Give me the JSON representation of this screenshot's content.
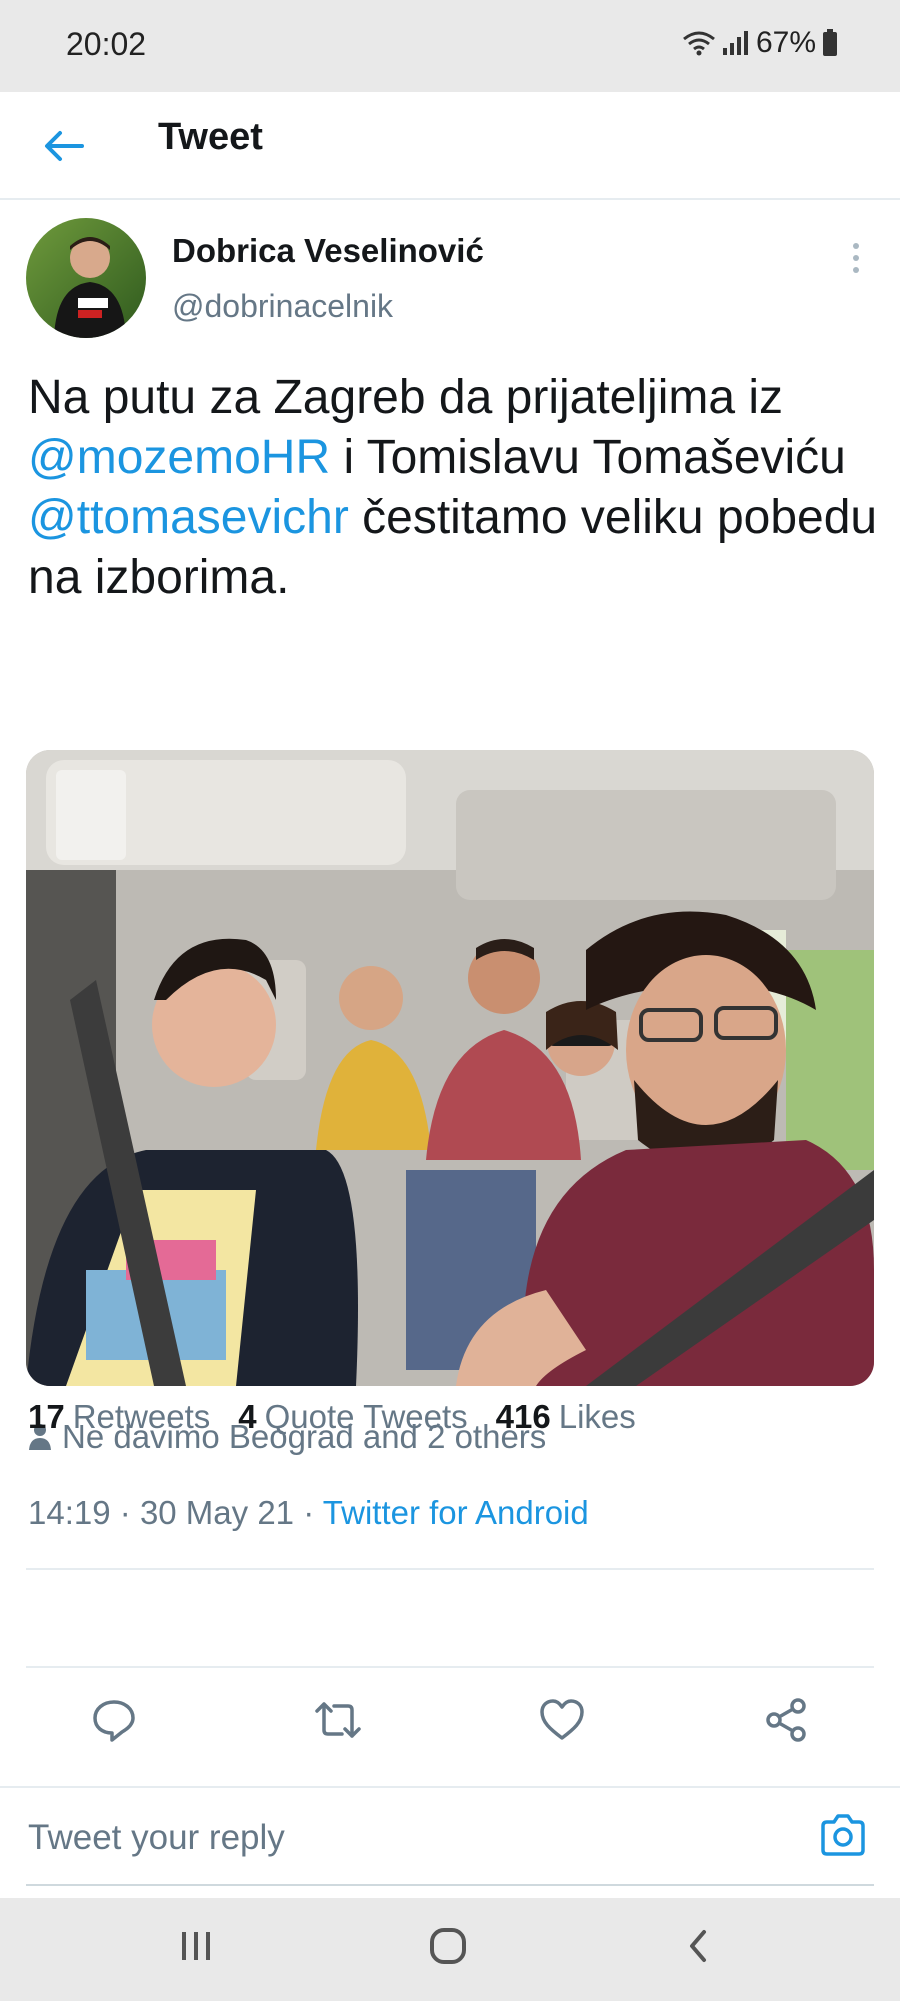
{
  "status_bar": {
    "time": "20:02",
    "battery": "67%"
  },
  "header": {
    "title": "Tweet"
  },
  "tweet": {
    "author_name": "Dobrica Veselinović",
    "author_handle": "@dobrinacelnik",
    "text_parts": [
      "Na putu za Zagreb da prijateljima iz ",
      "@mozemoHR",
      " i Tomislavu Tomaševiću ",
      "@ttomasevichr",
      " čestitamo veliku pobedu na izborima."
    ],
    "social_context": "Ne davimo Beograd and 2 others",
    "time": "14:19",
    "date": "30 May 21",
    "source": "Twitter for Android",
    "meta_separator": "·"
  },
  "stats": {
    "retweets_count": "17",
    "retweets_label": "Retweets",
    "quotes_count": "4",
    "quotes_label": "Quote Tweets",
    "likes_count": "416",
    "likes_label": "Likes"
  },
  "actions": [
    "reply-icon",
    "retweet-icon",
    "like-icon",
    "share-icon"
  ],
  "reply": {
    "placeholder": "Tweet your reply"
  },
  "colors": {
    "accent": "#1b95e0",
    "secondary_text": "#657786",
    "bars": "#e9e9e9"
  }
}
